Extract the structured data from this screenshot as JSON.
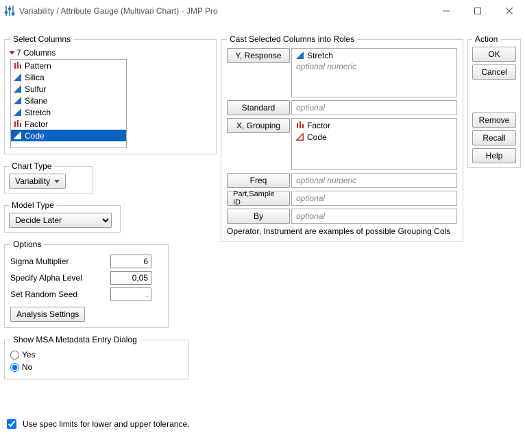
{
  "window": {
    "title": "Variability / Attribute Gauge (Multivari Chart) - JMP Pro"
  },
  "selectColumns": {
    "legend": "Select Columns",
    "countLabel": "7 Columns",
    "items": [
      {
        "name": "Pattern",
        "icon": "bars-red"
      },
      {
        "name": "Silica",
        "icon": "tri-blue"
      },
      {
        "name": "Sulfur",
        "icon": "tri-blue"
      },
      {
        "name": "Silane",
        "icon": "tri-blue"
      },
      {
        "name": "Stretch",
        "icon": "tri-blue"
      },
      {
        "name": "Factor",
        "icon": "bars-red"
      },
      {
        "name": "Code",
        "icon": "tri-outline-red",
        "selected": true
      }
    ]
  },
  "chartType": {
    "legend": "Chart Type",
    "value": "Variability"
  },
  "modelType": {
    "legend": "Model Type",
    "value": "Decide Later"
  },
  "options": {
    "legend": "Options",
    "sigmaLabel": "Sigma Multiplier",
    "sigmaValue": "6",
    "alphaLabel": "Specify Alpha Level",
    "alphaValue": "0,05",
    "seedLabel": "Set Random Seed",
    "seedValue": ".",
    "analysisSettings": "Analysis Settings"
  },
  "msa": {
    "legend": "Show MSA Metadata Entry Dialog",
    "yes": "Yes",
    "no": "No",
    "value": "No"
  },
  "specLimits": {
    "label": "Use spec limits for lower and upper tolerance.",
    "checked": true
  },
  "roles": {
    "legend": "Cast Selected Columns into Roles",
    "yLabel": "Y, Response",
    "yItems": [
      {
        "name": "Stretch",
        "icon": "tri-blue"
      }
    ],
    "yPlaceholder": "optional numeric",
    "standardLabel": "Standard",
    "standardPlaceholder": "optional",
    "xLabel": "X, Grouping",
    "xItems": [
      {
        "name": "Factor",
        "icon": "bars-red"
      },
      {
        "name": "Code",
        "icon": "tri-outline-red"
      }
    ],
    "freqLabel": "Freq",
    "freqPlaceholder": "optional numeric",
    "partLabel": "Part,Sample ID",
    "partPlaceholder": "optional",
    "byLabel": "By",
    "byPlaceholder": "optional",
    "hint": "Operator, Instrument are examples of possible Grouping Cols"
  },
  "actions": {
    "legend": "Action",
    "ok": "OK",
    "cancel": "Cancel",
    "remove": "Remove",
    "recall": "Recall",
    "help": "Help"
  }
}
